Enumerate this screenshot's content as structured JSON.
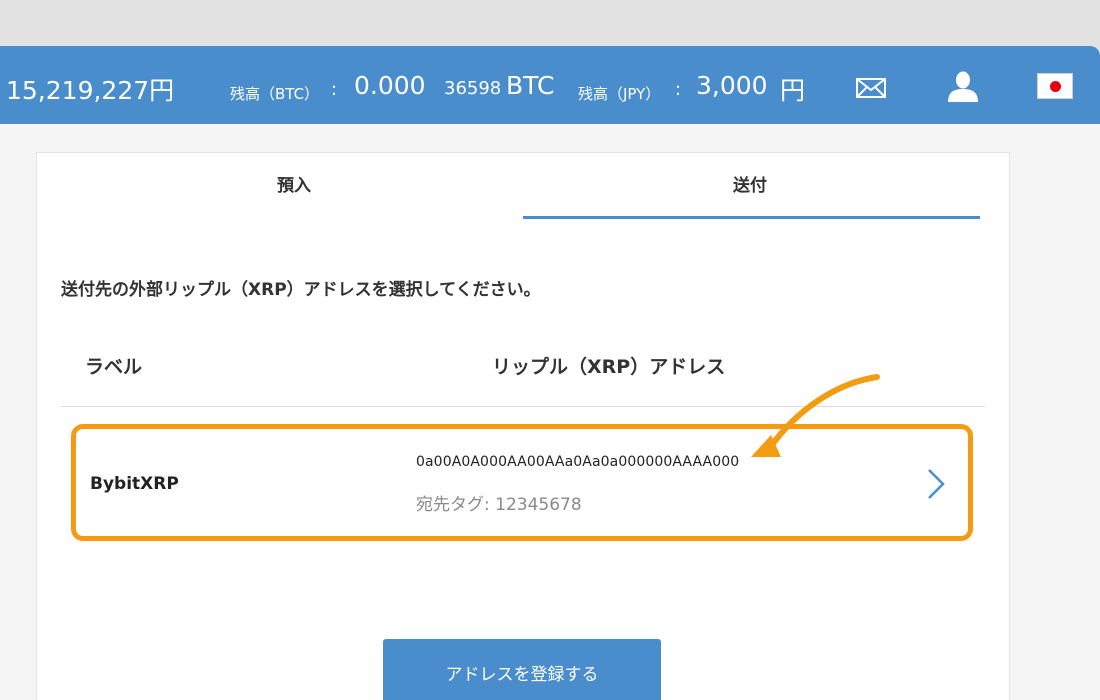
{
  "header": {
    "price": "15,219,227円",
    "btc_label": "残高（BTC）",
    "colon": ":",
    "btc_value_major": "0.000",
    "btc_value_minor": "36598",
    "btc_unit": "BTC",
    "jpy_label": "残高（JPY）",
    "jpy_value": "3,000",
    "jpy_unit": "円",
    "icons": [
      "mail-icon",
      "user-icon",
      "japan-flag-icon"
    ]
  },
  "tabs": [
    {
      "label": "預入",
      "active": false
    },
    {
      "label": "送付",
      "active": true
    }
  ],
  "instruction": "送付先の外部リップル（XRP）アドレスを選択してください。",
  "table": {
    "columns": [
      "ラベル",
      "リップル（XRP）アドレス"
    ],
    "rows": [
      {
        "label": "BybitXRP",
        "address": "0a00A0A000AA00AAa0Aa0a000000AAAA000",
        "tag": "宛先タグ: 12345678"
      }
    ]
  },
  "register_button": "アドレスを登録する",
  "colors": {
    "brand": "#4a8dcc",
    "highlight": "#f39c12"
  }
}
